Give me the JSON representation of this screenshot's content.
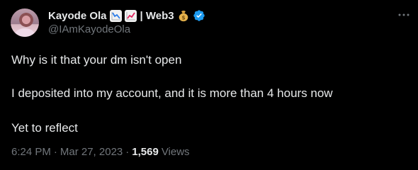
{
  "author": {
    "display_name": "Kayode Ola",
    "name_suffix": "| Web3",
    "handle": "@IAmKayodeOla",
    "icons": [
      "chart-decreasing-icon",
      "chart-increasing-icon",
      "money-bag-icon",
      "verified-badge-icon"
    ],
    "verified_color": "#1d9bf0"
  },
  "tweet": {
    "lines": [
      "Why is it that your dm isn't open",
      "I deposited into my account, and it is more than 4 hours now",
      "Yet to reflect"
    ],
    "time": "6:24 PM",
    "separator": "·",
    "date": "Mar 27, 2023",
    "views_count": "1,569",
    "views_label": "Views"
  },
  "colors": {
    "background": "#000000",
    "primary_text": "#e7e9ea",
    "secondary_text": "#71767b"
  }
}
